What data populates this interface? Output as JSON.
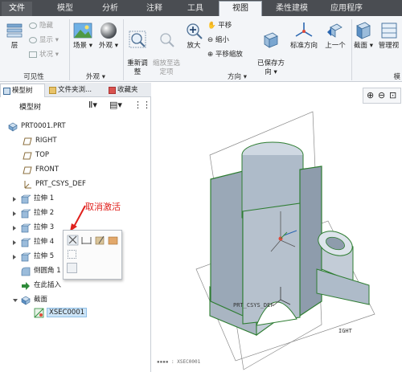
{
  "tabs": [
    "文件",
    "模型",
    "分析",
    "注释",
    "工具",
    "视图",
    "柔性建模",
    "应用程序"
  ],
  "ribbon": {
    "visibility": {
      "layer": "层",
      "hide": "隐藏",
      "show": "显示",
      "status": "状况",
      "group": "可见性"
    },
    "appearance": {
      "scene": "场景",
      "appearance": "外观",
      "group": "外观"
    },
    "orientation": {
      "refit": "重新调\n整",
      "zoom_selected": "缩放至选\n定项",
      "zoom_in": "放大",
      "pan": "平移",
      "zoom_out": "缩小",
      "pan_zoom": "平移缩放",
      "saved": "已保存方\n向",
      "std_orient": "标准方向",
      "prev": "上一个",
      "group": "方向"
    },
    "model_display": {
      "section": "截面",
      "manage_views": "管理视",
      "group_partial": "模"
    }
  },
  "panel_tabs": [
    "模型树",
    "文件夹浏...",
    "收藏夹"
  ],
  "model_tree": {
    "header": "模型树",
    "items": [
      "PRT0001.PRT",
      "RIGHT",
      "TOP",
      "FRONT",
      "PRT_CSYS_DEF",
      "拉伸 1",
      "拉伸 2",
      "拉伸 3",
      "拉伸 4",
      "拉伸 5",
      "倒圆角 1",
      "在此插入",
      "截面",
      "XSEC0001"
    ]
  },
  "annotation": "取消激活",
  "graphics": {
    "csys_label": "PRT_CSYS_DEF",
    "right_label": "IGHT",
    "xsec_label": "XSEC0001"
  },
  "colors": {
    "accent_red": "#e0201c",
    "tab_bar": "#4a4d52",
    "ribbon_bg": "#f3f5f8",
    "model_edge": "#2e7d32",
    "model_fill": "#b8c3cf"
  }
}
